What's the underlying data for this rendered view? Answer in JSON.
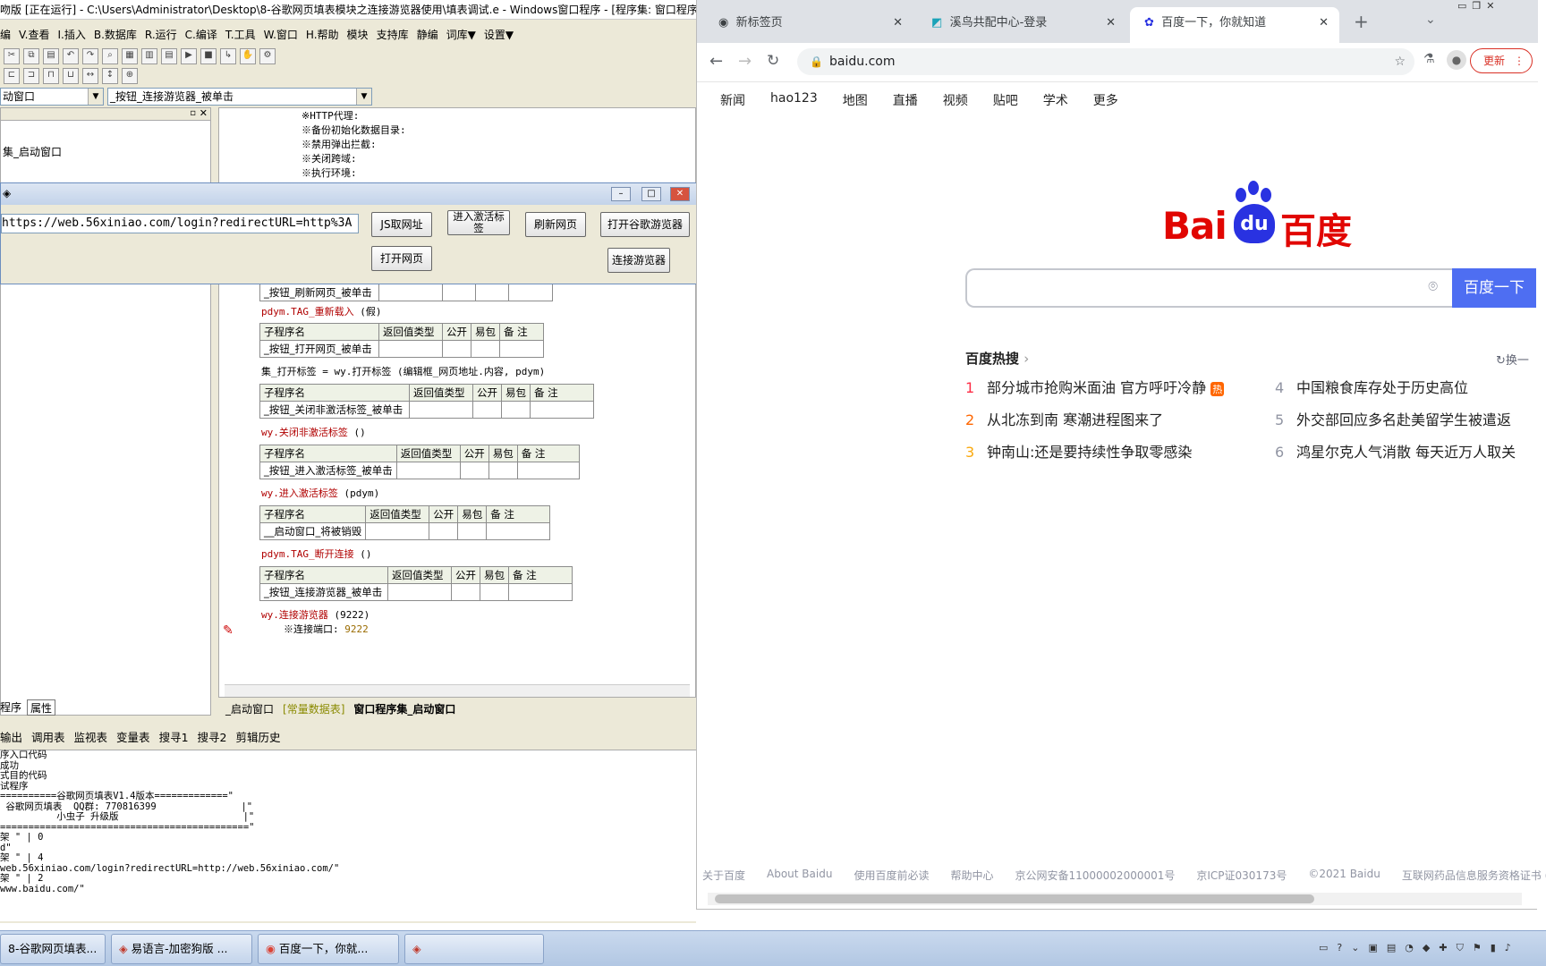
{
  "ide": {
    "title": "吻版 [正在运行] - C:\\Users\\Administrator\\Desktop\\8-谷歌网页填表模块之连接游览器使用\\填表调试.e - Windows窗口程序 - [程序集: 窗口程序集",
    "menu": [
      "编",
      "V.查看",
      "I.插入",
      "B.数据库",
      "R.运行",
      "C.编译",
      "T.工具",
      "W.窗口",
      "H.帮助",
      "模块",
      "支持库",
      "静编",
      "词库▼",
      "设置▼"
    ],
    "combo_left": "动窗口",
    "combo_right": "_按钮_连接游览器_被单击",
    "left_panel_item": "集_启动窗口",
    "left_tabs": [
      "程序",
      "属性"
    ],
    "editor_top_lines": [
      "※HTTP代理:",
      "※备份初始化数据目录:",
      "※禁用弹出拦截:",
      "※关闭跨域:",
      "※执行环境:"
    ],
    "sub_header": [
      "子程序名",
      "返回值类型",
      "公开",
      "易包",
      "备 注"
    ],
    "subs": [
      {
        "name": "_按钮_刷新网页_被单击",
        "code_kw": "pdym.TAG_重新载入",
        "code_rest": " (假)"
      },
      {
        "name": "_按钮_打开网页_被单击",
        "code_kw": "集_打开标签 = wy.打开标签",
        "code_rest": " (编辑框_网页地址.内容, pdym)"
      },
      {
        "name": "_按钮_关闭非激活标签_被单击",
        "code_kw": "wy.关闭非激活标签",
        "code_rest": " ()"
      },
      {
        "name": "_按钮_进入激活标签_被单击",
        "code_kw": "wy.进入激活标签",
        "code_rest": " (pdym)"
      },
      {
        "name": "__启动窗口_将被销毁",
        "code_kw": "pdym.TAG_断开连接",
        "code_rest": " ()"
      },
      {
        "name": "_按钮_连接游览器_被单击",
        "code_kw": "wy.连接游览器",
        "code_rest": " (9222)"
      }
    ],
    "port_line": "※连接端口:",
    "port_value": "9222",
    "editor_tabs": [
      "_启动窗口",
      "[常量数据表]",
      "窗口程序集_启动窗口"
    ],
    "bottom_tabs": [
      "输出",
      "调用表",
      "监视表",
      "变量表",
      "搜寻1",
      "搜寻2",
      "剪辑历史"
    ],
    "output_lines": [
      "序入口代码",
      "成功",
      "式目的代码",
      "试程序",
      "==========谷歌网页填表V1.4版本=============\"",
      " 谷歌网页填表  QQ群: 770816399               |\"",
      "          小虫子 升级版                      |\"",
      "============================================\"",
      "架 \" | 0",
      "d\"",
      "架 \" | 4",
      "web.56xiniao.com/login?redirectURL=http://web.56xiniao.com/\"",
      "架 \" | 2",
      "www.baidu.com/\""
    ]
  },
  "popup": {
    "url_value": "https://web.56xiniao.com/login?redirectURL=http%3A",
    "buttons": {
      "js_url": "JS取网址",
      "enter_tab": "进入激活标签",
      "refresh": "刷新网页",
      "open_chrome": "打开谷歌游览器",
      "open_page": "打开网页",
      "connect": "连接游览器"
    }
  },
  "browser": {
    "tabs": [
      "新标签页",
      "溪鸟共配中心-登录",
      "百度一下，你就知道"
    ],
    "url": "baidu.com",
    "update_label": "更新",
    "nav_links": [
      "新闻",
      "hao123",
      "地图",
      "直播",
      "视频",
      "贴吧",
      "学术",
      "更多"
    ],
    "logo_text_left": "Bai",
    "logo_text_du": "du",
    "logo_text_cn": "百度",
    "search_button": "百度一下",
    "hot_title": "百度热搜",
    "hot_refresh": "换一",
    "hot_badge": "热",
    "hot_items": [
      {
        "n": "1",
        "text": "部分城市抢购米面油 官方呼吁冷静"
      },
      {
        "n": "2",
        "text": "从北冻到南 寒潮进程图来了"
      },
      {
        "n": "3",
        "text": "钟南山:还是要持续性争取零感染"
      },
      {
        "n": "4",
        "text": "中国粮食库存处于历史高位"
      },
      {
        "n": "5",
        "text": "外交部回应多名赴美留学生被遣返"
      },
      {
        "n": "6",
        "text": "鸿星尔克人气消散 每天近万人取关"
      }
    ],
    "footer": [
      "关于百度",
      "About Baidu",
      "使用百度前必读",
      "帮助中心",
      "京公网安备11000002000001号",
      "京ICP证030173号",
      "©2021 Baidu",
      "互联网药品信息服务资格证书 (京)-经营"
    ],
    "colors": {
      "baidu_blue": "#2932e1",
      "baidu_red": "#e10602",
      "search_btn": "#4e6ef2",
      "hot_orange": "#f60"
    }
  },
  "taskbar": {
    "items": [
      "8-谷歌网页填表...",
      "易语言-加密狗版 ...",
      "百度一下，你就..."
    ]
  }
}
